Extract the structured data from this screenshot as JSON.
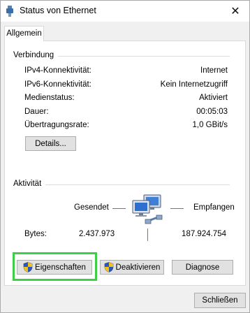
{
  "window": {
    "title": "Status von Ethernet",
    "close_glyph": "✕"
  },
  "tabs": [
    {
      "label": "Allgemein"
    }
  ],
  "connection": {
    "group_label": "Verbindung",
    "rows": [
      {
        "label": "IPv4-Konnektivität:",
        "value": "Internet"
      },
      {
        "label": "IPv6-Konnektivität:",
        "value": "Kein Internetzugriff"
      },
      {
        "label": "Medienstatus:",
        "value": "Aktiviert"
      },
      {
        "label": "Dauer:",
        "value": "00:05:03"
      },
      {
        "label": "Übertragungsrate:",
        "value": "1,0 GBit/s"
      }
    ],
    "details_button": "Details..."
  },
  "activity": {
    "group_label": "Aktivität",
    "sent_label": "Gesendet",
    "received_label": "Empfangen",
    "bytes_label": "Bytes:",
    "bytes_sent": "2.437.973",
    "bytes_received": "187.924.754"
  },
  "actions": {
    "properties": "Eigenschaften",
    "deactivate": "Deaktivieren",
    "diagnose": "Diagnose"
  },
  "footer": {
    "close_button": "Schließen"
  },
  "icons": {
    "window_icon": "ethernet-plug-icon",
    "network_icon": "network-computers-icon",
    "uac_shield": "uac-shield-icon"
  },
  "colors": {
    "highlight": "#3dd047",
    "background": "#f0f0f0"
  }
}
